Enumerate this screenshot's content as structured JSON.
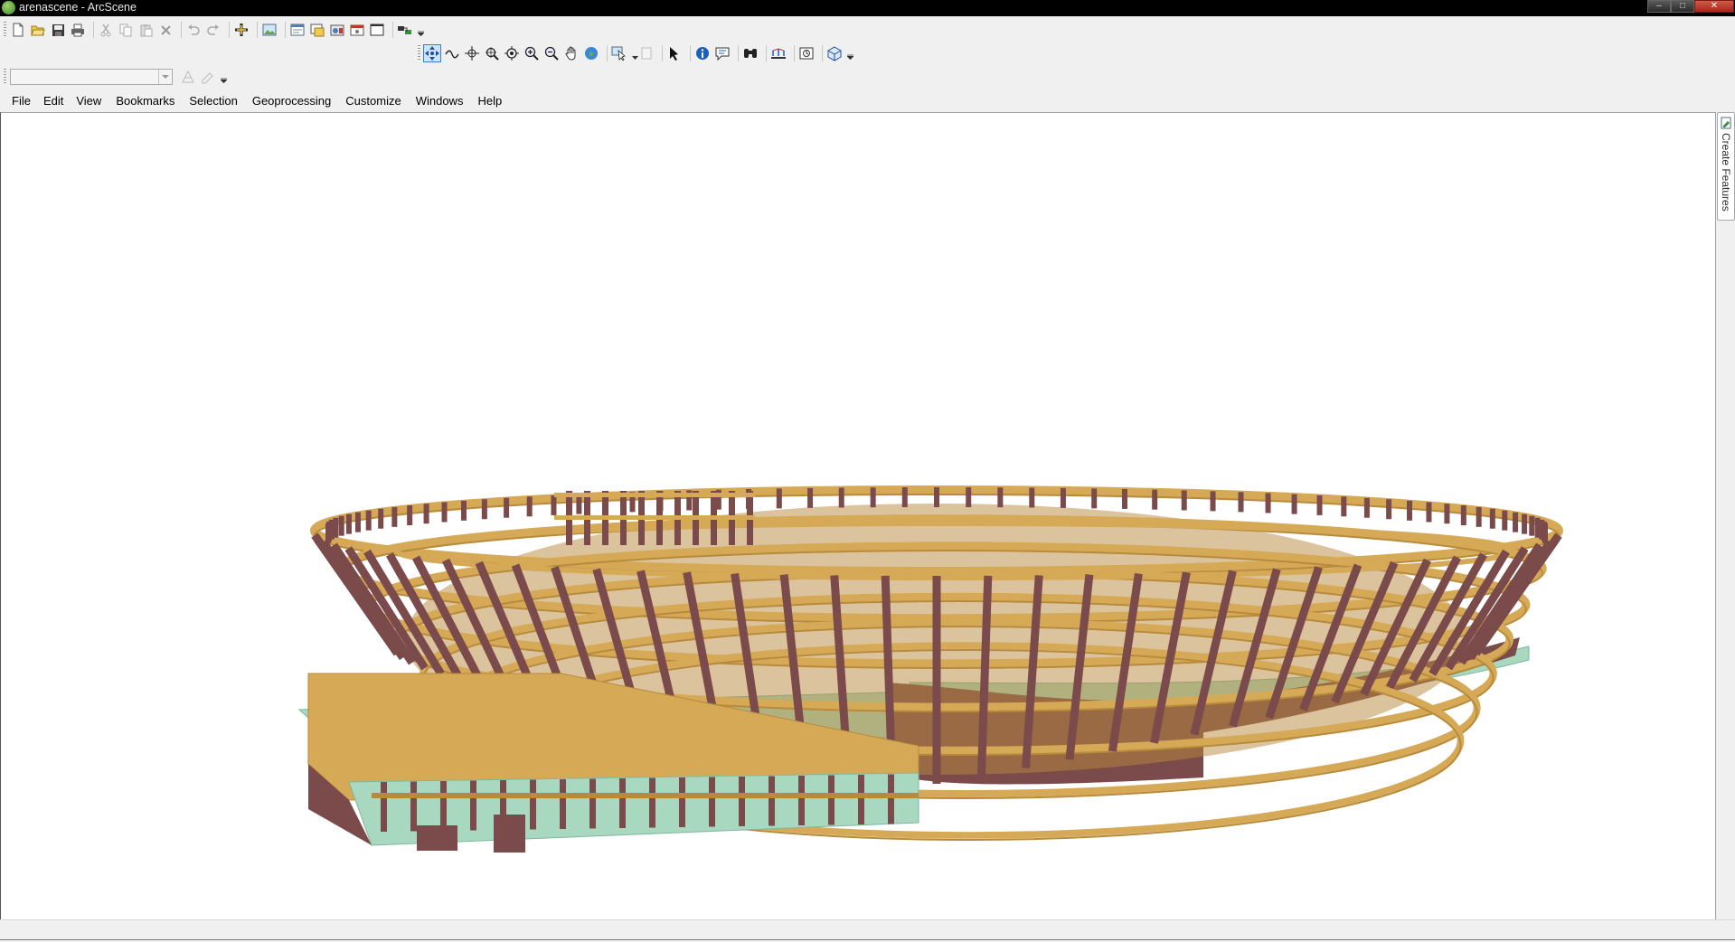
{
  "window": {
    "title": "arenascene - ArcScene",
    "controls": {
      "minimize": "–",
      "maximize": "□",
      "close": "✕"
    }
  },
  "menubar": {
    "items": [
      "File",
      "Edit",
      "View",
      "Bookmarks",
      "Selection",
      "Geoprocessing",
      "Customize",
      "Windows",
      "Help"
    ]
  },
  "toolbars": {
    "standard_icons": [
      "new-document-icon",
      "open-folder-icon",
      "save-icon",
      "print-icon",
      "cut-icon",
      "copy-icon",
      "paste-icon",
      "delete-icon",
      "undo-icon",
      "redo-icon",
      "add-data-icon",
      "export-scene-icon",
      "scene-properties-icon",
      "layer-properties-icon",
      "animation-icon",
      "window-icon",
      "arctoolbox-icon"
    ],
    "tools_icons": [
      "navigate-icon",
      "fly-icon",
      "target-center-icon",
      "zoom-to-target-icon",
      "set-observer-icon",
      "zoom-in-icon",
      "zoom-out-icon",
      "pan-icon",
      "full-extent-icon",
      "select-features-icon",
      "clear-selection-icon",
      "select-elements-icon",
      "identify-icon",
      "html-popup-icon",
      "find-icon",
      "measure-icon",
      "swipe-icon",
      "3d-effects-icon"
    ],
    "layer_combo_value": ""
  },
  "side_tab": {
    "label": "Create Features"
  },
  "scene": {
    "colors": {
      "floor": "#d6a957",
      "floor_dark": "#b88a3c",
      "column": "#7b4a4b",
      "column_dark": "#5f3536",
      "base": "#a8d8c0",
      "base_edge": "#7fb79c",
      "background": "#ffffff"
    }
  }
}
